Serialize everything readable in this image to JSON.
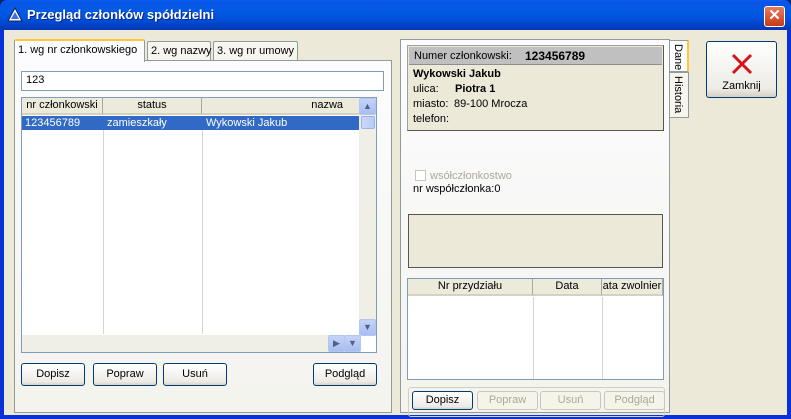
{
  "window": {
    "title": "Przegląd członków spółdzielni"
  },
  "left_tabs": [
    {
      "label": "1. wg nr członkowskiego"
    },
    {
      "label": "2. wg nazwy"
    },
    {
      "label": "3. wg nr umowy"
    }
  ],
  "search": {
    "value": "123"
  },
  "members_table": {
    "columns": [
      "nr członkowski",
      "status",
      "nazwa"
    ],
    "rows": [
      {
        "nr": "123456789",
        "status": "zamieszkały",
        "nazwa": "Wykowski Jakub"
      }
    ]
  },
  "left_buttons": {
    "add": "Dopisz",
    "edit": "Popraw",
    "delete": "Usuń",
    "preview": "Podgląd"
  },
  "details": {
    "member_number_label": "Numer członkowski:",
    "member_number": "123456789",
    "name": "Wykowski Jakub",
    "street_label": "ulica:",
    "street": "Piotra 1",
    "city_label": "miasto:",
    "city": "89-100 Mrocza",
    "phone_label": "telefon:",
    "phone": "",
    "co_membership_label": "wsółczłonkostwo",
    "co_member_number": "nr współczłonka:0"
  },
  "allocation_table": {
    "columns": [
      "Nr przydziału",
      "Data",
      "ata zwolnier"
    ]
  },
  "right_buttons": {
    "add": "Dopisz",
    "edit": "Popraw",
    "delete": "Usuń",
    "preview": "Podgląd"
  },
  "side_tabs": {
    "data": "Dane",
    "history": "Historia"
  },
  "close_button": {
    "label": "Zamknij"
  }
}
